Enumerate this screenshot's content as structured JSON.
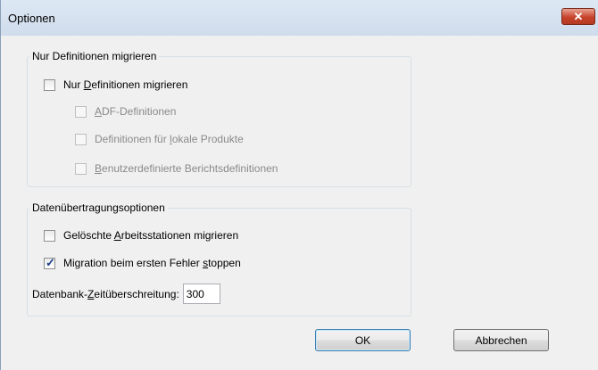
{
  "window": {
    "title": "Optionen",
    "close_glyph": "✕"
  },
  "group1": {
    "title": "Nur Definitionen migrieren",
    "main_checkbox": {
      "pre": "Nur ",
      "mnemonic": "D",
      "post": "efinitionen migrieren",
      "checked": false
    },
    "sub_items": [
      {
        "pre": "",
        "mnemonic": "A",
        "post": "DF-Definitionen",
        "checked": false,
        "enabled": false
      },
      {
        "pre": "Definitionen für ",
        "mnemonic": "l",
        "post": "okale Produkte",
        "checked": false,
        "enabled": false
      },
      {
        "pre": "",
        "mnemonic": "B",
        "post": "enutzerdefinierte Berichtsdefinitionen",
        "checked": false,
        "enabled": false
      }
    ]
  },
  "group2": {
    "title": "Datenübertragungsoptionen",
    "items": [
      {
        "pre": "Gelöschte ",
        "mnemonic": "A",
        "post": "rbeitsstationen migrieren",
        "checked": false
      },
      {
        "pre": "Migration beim ersten Fehler ",
        "mnemonic": "s",
        "post": "toppen",
        "checked": true
      }
    ],
    "timeout": {
      "pre": "Datenbank-",
      "mnemonic": "Z",
      "post": "eitüberschreitung:",
      "value": "300"
    }
  },
  "buttons": {
    "ok": "OK",
    "cancel": "Abbrechen"
  }
}
